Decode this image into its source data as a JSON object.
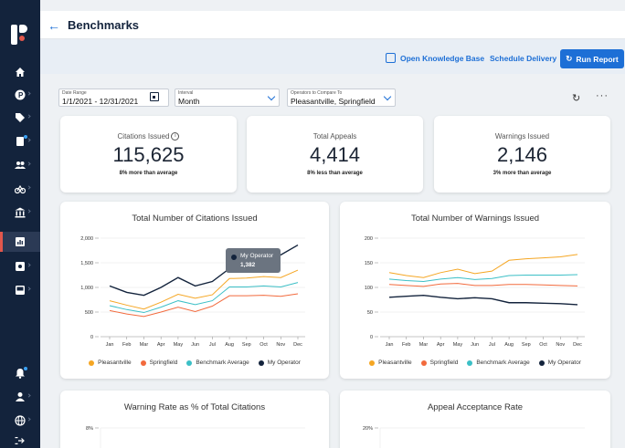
{
  "page": {
    "title": "Benchmarks"
  },
  "actions": {
    "open_kb": "Open Knowledge Base",
    "schedule": "Schedule Delivery",
    "run": "Run Report"
  },
  "filters": {
    "date_range": {
      "label": "Date Range",
      "value": "1/1/2021 - 12/31/2021"
    },
    "interval": {
      "label": "Interval",
      "value": "Month"
    },
    "operators": {
      "label": "Operators to Compare To",
      "value": "Pleasantville, Springfield"
    }
  },
  "kpis": [
    {
      "label": "Citations Issued",
      "value": "115,625",
      "delta": "8% more than average"
    },
    {
      "label": "Total Appeals",
      "value": "4,414",
      "delta": "8% less than average"
    },
    {
      "label": "Warnings Issued",
      "value": "2,146",
      "delta": "3% more than average"
    }
  ],
  "colors": {
    "pleasantville": "#f5a623",
    "springfield": "#f26a3d",
    "benchmark": "#3bbfc6",
    "operator": "#13233c",
    "accent": "#1d6fd6"
  },
  "tooltip": {
    "name": "My Operator",
    "value": "1,382"
  },
  "legend": [
    "Pleasantville",
    "Springfield",
    "Benchmark Average",
    "My Operator"
  ],
  "chart_data": [
    {
      "type": "line",
      "title": "Total Number of Citations Issued",
      "categories": [
        "Jan",
        "Feb",
        "Mar",
        "Apr",
        "May",
        "Jun",
        "Jul",
        "Aug",
        "Sep",
        "Oct",
        "Nov",
        "Dec"
      ],
      "yticks": [
        "0",
        "500",
        "1,000",
        "1,500",
        "2,000"
      ],
      "ylim": [
        0,
        2000
      ],
      "legend_position": "bottom",
      "series": [
        {
          "name": "Pleasantville",
          "values": [
            730,
            640,
            560,
            700,
            860,
            780,
            850,
            1180,
            1190,
            1220,
            1200,
            1350
          ]
        },
        {
          "name": "Springfield",
          "values": [
            530,
            460,
            410,
            500,
            600,
            510,
            620,
            830,
            830,
            840,
            820,
            870
          ]
        },
        {
          "name": "Benchmark Average",
          "values": [
            630,
            550,
            490,
            600,
            730,
            650,
            730,
            1010,
            1010,
            1030,
            1010,
            1100
          ]
        },
        {
          "name": "My Operator",
          "values": [
            1030,
            900,
            840,
            1000,
            1200,
            1030,
            1120,
            1382,
            1460,
            1560,
            1660,
            1860
          ]
        }
      ]
    },
    {
      "type": "line",
      "title": "Total Number of Warnings Issued",
      "categories": [
        "Jan",
        "Feb",
        "Mar",
        "Apr",
        "May",
        "Jun",
        "Jul",
        "Aug",
        "Sep",
        "Oct",
        "Nov",
        "Dec"
      ],
      "yticks": [
        "0",
        "50",
        "100",
        "150",
        "200"
      ],
      "ylim": [
        0,
        200
      ],
      "legend_position": "bottom",
      "series": [
        {
          "name": "Pleasantville",
          "values": [
            130,
            124,
            120,
            130,
            137,
            128,
            133,
            155,
            158,
            160,
            162,
            167
          ]
        },
        {
          "name": "Springfield",
          "values": [
            106,
            104,
            102,
            107,
            108,
            104,
            104,
            106,
            106,
            105,
            104,
            103
          ]
        },
        {
          "name": "Benchmark Average",
          "values": [
            117,
            114,
            112,
            117,
            120,
            116,
            118,
            124,
            125,
            125,
            125,
            126
          ]
        },
        {
          "name": "My Operator",
          "values": [
            80,
            82,
            84,
            80,
            77,
            79,
            77,
            69,
            69,
            68,
            67,
            65
          ]
        }
      ]
    },
    {
      "type": "line",
      "title": "Warning Rate as % of Total Citations",
      "yticks": [
        "8%"
      ]
    },
    {
      "type": "line",
      "title": "Appeal Acceptance Rate",
      "yticks": [
        "20%"
      ]
    }
  ]
}
